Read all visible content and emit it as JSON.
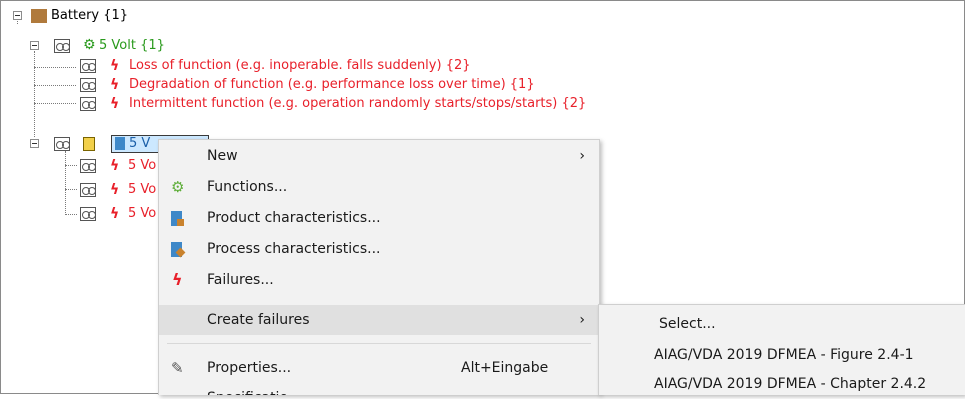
{
  "tree": {
    "root": {
      "label": "Battery {1}"
    },
    "function_node": {
      "label": "5 Volt {1}"
    },
    "failures": [
      {
        "label": "Loss of function (e.g. inoperable. falls suddenly) {2}"
      },
      {
        "label": "Degradation of function (e.g. performance loss over time) {1}"
      },
      {
        "label": "Intermittent function (e.g. operation randomly starts/stops/starts) {2}"
      }
    ],
    "selected_node": {
      "label": "5 V"
    },
    "child_rows": [
      {
        "label": "5 Vo"
      },
      {
        "label": "5 Vo"
      },
      {
        "label": "5 Vo"
      }
    ]
  },
  "context_menu": {
    "items": [
      {
        "label": "New",
        "has_submenu": true,
        "icon": "none"
      },
      {
        "label": "Functions...",
        "icon": "gears-icon"
      },
      {
        "label": "Product characteristics...",
        "icon": "product-characteristic-icon"
      },
      {
        "label": "Process characteristics...",
        "icon": "process-characteristic-icon"
      },
      {
        "label": "Failures...",
        "icon": "lightning-icon"
      },
      {
        "label": "Create failures",
        "has_submenu": true,
        "highlighted": true,
        "icon": "none"
      },
      {
        "label": "Properties...",
        "shortcut": "Alt+Eingabe",
        "icon": "pencil-icon"
      },
      {
        "label": "Specificatio"
      }
    ]
  },
  "submenu": {
    "items": [
      {
        "label": "Select..."
      },
      {
        "label": "AIAG/VDA 2019 DFMEA - Figure 2.4-1"
      },
      {
        "label": "AIAG/VDA 2019 DFMEA - Chapter 2.4.2"
      }
    ]
  },
  "colors": {
    "failure_red": "#e8202a",
    "function_green": "#2a9a1d",
    "battery_brown": "#b07a3c",
    "selection_blue": "#cce8ff"
  }
}
